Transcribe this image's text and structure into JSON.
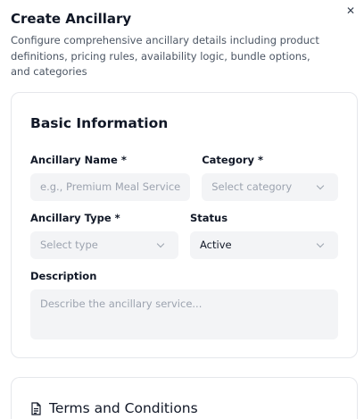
{
  "dialog": {
    "title": "Create Ancillary",
    "description": "Configure comprehensive ancillary details including product definitions, pricing rules, availability logic, bundle options, and categories",
    "close_icon": "close-icon"
  },
  "basic_info": {
    "title": "Basic Information",
    "name": {
      "label": "Ancillary Name *",
      "placeholder": "e.g., Premium Meal Service",
      "value": ""
    },
    "category": {
      "label": "Category *",
      "placeholder": "Select category",
      "value": ""
    },
    "type": {
      "label": "Ancillary Type *",
      "placeholder": "Select type",
      "value": ""
    },
    "status": {
      "label": "Status",
      "value": "Active"
    },
    "description": {
      "label": "Description",
      "placeholder": "Describe the ancillary service..."
    }
  },
  "terms": {
    "title": "Terms and Conditions",
    "icon": "document-icon"
  }
}
